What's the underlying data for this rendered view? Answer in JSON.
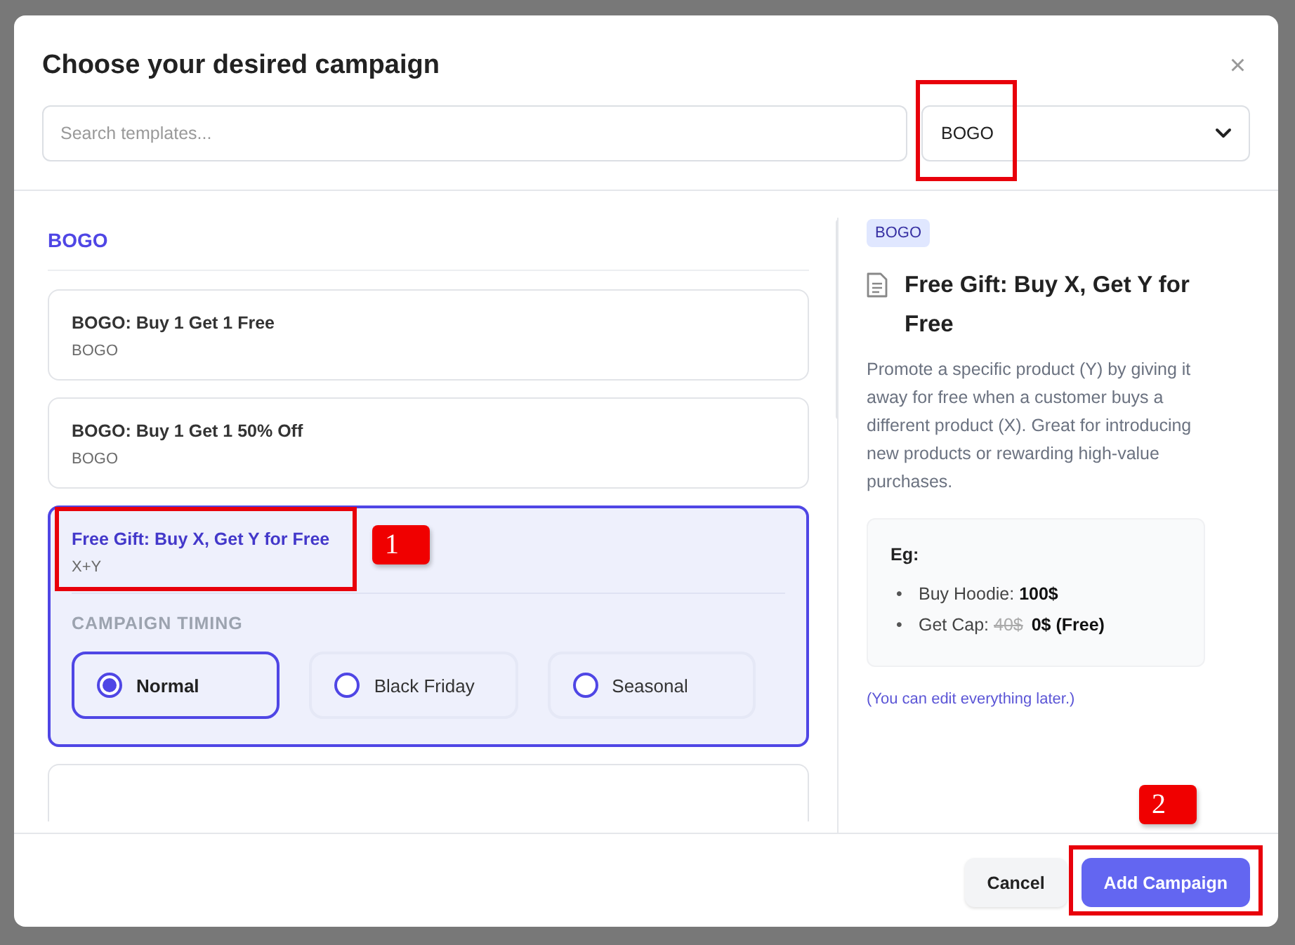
{
  "dialog": {
    "title": "Choose your desired campaign",
    "close": "×"
  },
  "search": {
    "placeholder": "Search templates..."
  },
  "category_select": {
    "value": "BOGO"
  },
  "group": {
    "heading": "BOGO"
  },
  "templates": [
    {
      "title": "BOGO: Buy 1 Get 1 Free",
      "subtitle": "BOGO",
      "selected": false
    },
    {
      "title": "BOGO: Buy 1 Get 1 50% Off",
      "subtitle": "BOGO",
      "selected": false
    },
    {
      "title": "Free Gift: Buy X, Get Y for Free",
      "subtitle": "X+Y",
      "selected": true,
      "timing": {
        "label": "CAMPAIGN TIMING",
        "options": [
          {
            "label": "Normal",
            "selected": true
          },
          {
            "label": "Black Friday",
            "selected": false
          },
          {
            "label": "Seasonal",
            "selected": false
          }
        ]
      }
    }
  ],
  "preview": {
    "tag": "BOGO",
    "title": "Free Gift: Buy X, Get Y for Free",
    "description": "Promote a specific product (Y) by giving it away for free when a customer buys a different product (X). Great for introducing new products or rewarding high-value purchases.",
    "example": {
      "heading": "Eg:",
      "items": [
        {
          "bullet": "•",
          "label": "Buy Hoodie:",
          "price": "100$"
        },
        {
          "bullet": "•",
          "label": "Get Cap:",
          "old_price": "40$",
          "price": "0$ (Free)"
        }
      ]
    },
    "note": "(You can edit everything later.)"
  },
  "buttons": [
    {
      "label": "Cancel",
      "kind": "secondary"
    },
    {
      "label": "Add Campaign",
      "kind": "primary"
    }
  ],
  "annotations": [
    {
      "label": "1"
    },
    {
      "label": "2"
    }
  ]
}
